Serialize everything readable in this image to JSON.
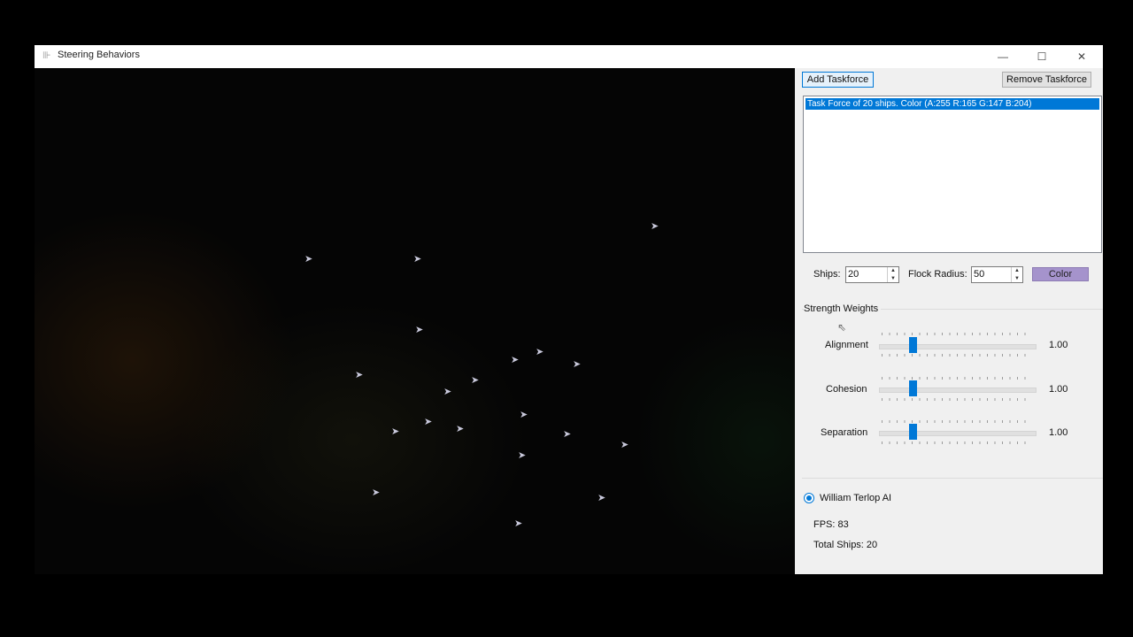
{
  "window": {
    "title": "Steering Behaviors",
    "controls": {
      "minimize": "—",
      "maximize": "☐",
      "close": "✕"
    }
  },
  "toolbar": {
    "add_label": "Add Taskforce",
    "remove_label": "Remove Taskforce"
  },
  "taskforces": [
    "Task Force of 20 ships. Color (A:255 R:165 G:147 B:204)"
  ],
  "settings": {
    "ships_label": "Ships:",
    "ships_value": "20",
    "radius_label": "Flock Radius:",
    "radius_value": "50",
    "color_label": "Color",
    "color_hex": "#a593cc"
  },
  "weights": {
    "title": "Strength Weights",
    "alignment": {
      "label": "Alignment",
      "value": "1.00"
    },
    "cohesion": {
      "label": "Cohesion",
      "value": "1.00"
    },
    "separation": {
      "label": "Separation",
      "value": "1.00"
    }
  },
  "ai": {
    "label": "William Terlop AI",
    "selected": true
  },
  "stats": {
    "fps": "FPS: 83",
    "total": "Total Ships: 20"
  }
}
